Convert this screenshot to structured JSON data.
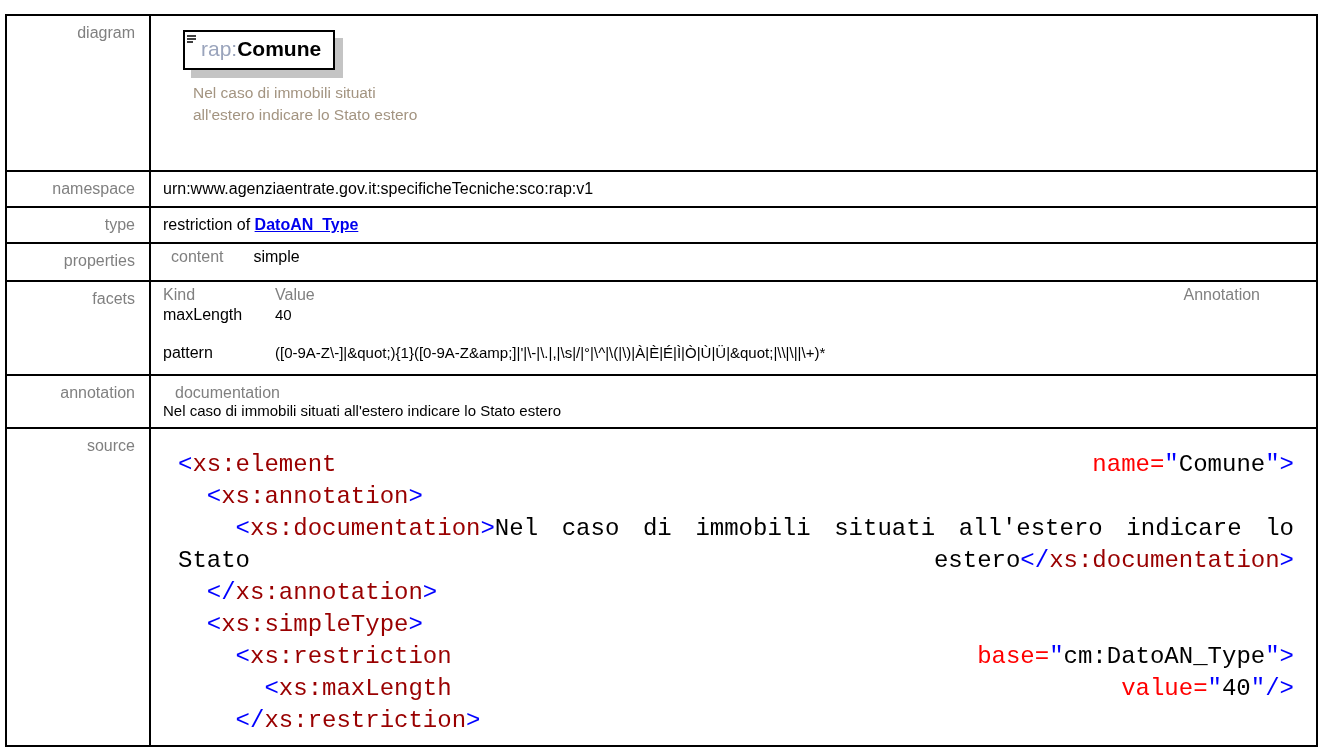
{
  "rows": [
    {
      "kind": "diagram",
      "label": "diagram",
      "element": {
        "prefix": "rap:",
        "name": "Comune"
      },
      "caption": "Nel caso di immobili situati all'estero indicare lo Stato estero"
    },
    {
      "kind": "text",
      "label": "namespace",
      "value": "urn:www.agenziaentrate.gov.it:specificheTecniche:sco:rap:v1"
    },
    {
      "kind": "type",
      "label": "type",
      "prefix": "restriction of",
      "link": "DatoAN_Type"
    },
    {
      "kind": "properties",
      "label": "properties",
      "items": [
        {
          "key": "content",
          "value": "simple"
        }
      ]
    },
    {
      "kind": "facets",
      "label": "facets",
      "headings": [
        "Kind",
        "Value",
        "Annotation"
      ],
      "facets": [
        {
          "name": "maxLength",
          "value": "40"
        },
        {
          "name": "pattern",
          "value": "([0-9A-Z\\-]|&quot;){1}([0-9A-Z&amp;]|'|\\-|\\.|,|\\s|/|°|\\^|\\(|\\)|À|È|É|Ì|Ò|Ù|Ü|&quot;|\\\\|\\||\\+)*"
        }
      ]
    },
    {
      "kind": "annotation",
      "label": "annotation",
      "heading": "documentation",
      "text": "Nel caso di immobili situati all'estero indicare lo Stato estero"
    },
    {
      "kind": "source",
      "label": "source",
      "lines": [
        [
          [
            {
              "kind": "punct",
              "text": "<"
            },
            {
              "kind": "tag",
              "text": "xs:element"
            }
          ],
          [
            {
              "kind": "attr",
              "text": "name="
            },
            {
              "kind": "punct",
              "text": "\""
            },
            {
              "kind": "text",
              "text": "Comune"
            },
            {
              "kind": "punct",
              "text": "\">"
            }
          ]
        ],
        [
          [
            {
              "kind": "punct",
              "text": "  <"
            },
            {
              "kind": "tag",
              "text": "xs:annotation"
            },
            {
              "kind": "punct",
              "text": ">"
            }
          ]
        ],
        [
          [
            {
              "kind": "punct",
              "text": "    <"
            },
            {
              "kind": "tag",
              "text": "xs:documentation"
            },
            {
              "kind": "punct",
              "text": ">"
            },
            {
              "kind": "text",
              "text": "Nel"
            }
          ],
          [
            {
              "kind": "text",
              "text": "caso"
            }
          ],
          [
            {
              "kind": "text",
              "text": "di"
            }
          ],
          [
            {
              "kind": "text",
              "text": "immobili"
            }
          ],
          [
            {
              "kind": "text",
              "text": "situati"
            }
          ],
          [
            {
              "kind": "text",
              "text": "all'estero"
            }
          ],
          [
            {
              "kind": "text",
              "text": "indicare"
            }
          ],
          [
            {
              "kind": "text",
              "text": "lo"
            }
          ]
        ],
        [
          [
            {
              "kind": "text",
              "text": "Stato"
            }
          ],
          [
            {
              "kind": "text",
              "text": "estero"
            },
            {
              "kind": "punct",
              "text": "</"
            },
            {
              "kind": "tag",
              "text": "xs:documentation"
            },
            {
              "kind": "punct",
              "text": ">"
            }
          ]
        ],
        [
          [
            {
              "kind": "punct",
              "text": "  </"
            },
            {
              "kind": "tag",
              "text": "xs:annotation"
            },
            {
              "kind": "punct",
              "text": ">"
            }
          ]
        ],
        [
          [
            {
              "kind": "punct",
              "text": "  <"
            },
            {
              "kind": "tag",
              "text": "xs:simpleType"
            },
            {
              "kind": "punct",
              "text": ">"
            }
          ]
        ],
        [
          [
            {
              "kind": "punct",
              "text": "    <"
            },
            {
              "kind": "tag",
              "text": "xs:restriction"
            }
          ],
          [
            {
              "kind": "attr",
              "text": "base="
            },
            {
              "kind": "punct",
              "text": "\""
            },
            {
              "kind": "text",
              "text": "cm:DatoAN_Type"
            },
            {
              "kind": "punct",
              "text": "\">"
            }
          ]
        ],
        [
          [
            {
              "kind": "punct",
              "text": "      <"
            },
            {
              "kind": "tag",
              "text": "xs:maxLength"
            }
          ],
          [
            {
              "kind": "attr",
              "text": "value="
            },
            {
              "kind": "punct",
              "text": "\""
            },
            {
              "kind": "text",
              "text": "40"
            },
            {
              "kind": "punct",
              "text": "\"/>"
            }
          ]
        ],
        [
          [
            {
              "kind": "punct",
              "text": "    </"
            },
            {
              "kind": "tag",
              "text": "xs:restriction"
            },
            {
              "kind": "punct",
              "text": ">"
            }
          ]
        ]
      ]
    }
  ]
}
